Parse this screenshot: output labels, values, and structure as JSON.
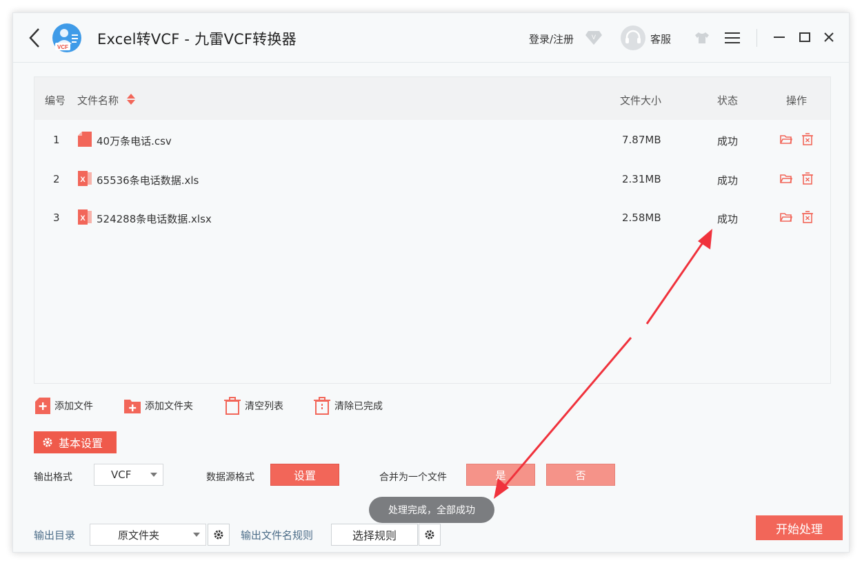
{
  "app": {
    "title": "Excel转VCF - 九雷VCF转换器",
    "logo_text": "VCF",
    "login_label": "登录/注册",
    "vip_badge": "V",
    "service_label": "客服"
  },
  "table": {
    "headers": {
      "index": "编号",
      "name": "文件名称",
      "size": "文件大小",
      "status": "状态",
      "ops": "操作"
    },
    "rows": [
      {
        "index": "1",
        "name": "40万条电话.csv",
        "size": "7.87MB",
        "status": "成功",
        "type": "csv"
      },
      {
        "index": "2",
        "name": "65536条电话数据.xls",
        "size": "2.31MB",
        "status": "成功",
        "type": "excel"
      },
      {
        "index": "3",
        "name": "524288条电话数据.xlsx",
        "size": "2.58MB",
        "status": "成功",
        "type": "excel"
      }
    ]
  },
  "toolbar": {
    "add_file": "添加文件",
    "add_folder": "添加文件夹",
    "clear_list": "清空列表",
    "clear_done": "清除已完成"
  },
  "settings": {
    "tab_label": "基本设置",
    "output_format_label": "输出格式",
    "output_format_value": "VCF",
    "data_source_label": "数据源格式",
    "data_source_button": "设置",
    "merge_label": "合并为一个文件",
    "merge_yes": "是",
    "merge_no": "否",
    "output_dir_label": "输出目录",
    "output_dir_value": "原文件夹",
    "filename_rule_label": "输出文件名规则",
    "filename_rule_button": "选择规则"
  },
  "toast": "处理完成，全部成功",
  "start_button": "开始处理",
  "colors": {
    "accent": "#f26659",
    "annotation_arrow": "#f0323c"
  }
}
